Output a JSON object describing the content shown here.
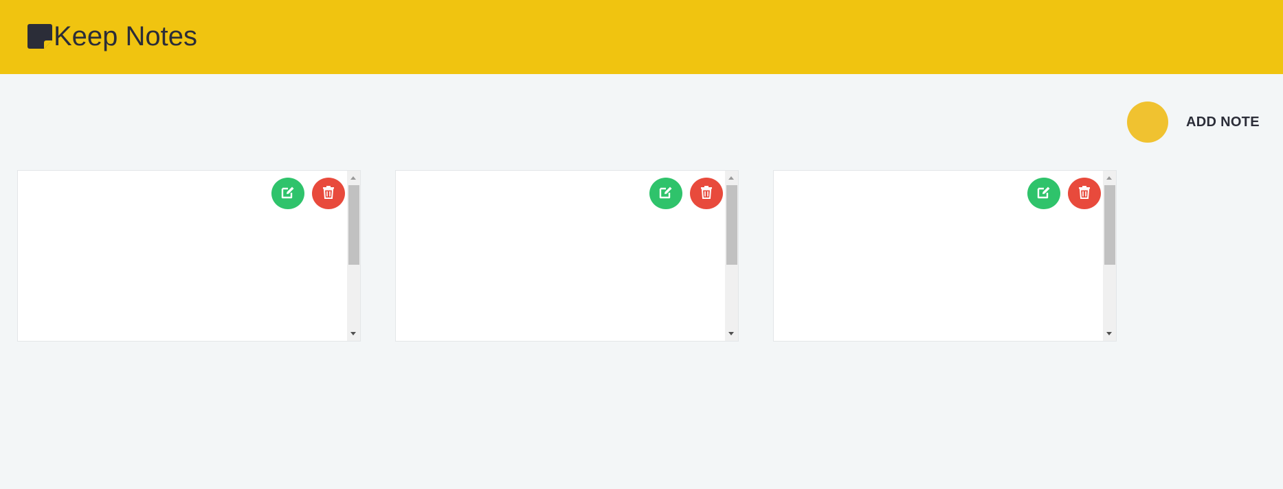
{
  "header": {
    "app_title": "Keep Notes",
    "logo_icon": "sticky-note-icon",
    "background_color": "#f0c410"
  },
  "toolbar": {
    "add_note_label": "ADD NOTE",
    "add_button_color": "#f0c230"
  },
  "notes": [
    {
      "edit_icon": "edit-icon",
      "delete_icon": "trash-icon"
    },
    {
      "edit_icon": "edit-icon",
      "delete_icon": "trash-icon"
    },
    {
      "edit_icon": "edit-icon",
      "delete_icon": "trash-icon"
    }
  ],
  "colors": {
    "edit": "#2fc36b",
    "delete": "#e84a3c",
    "page_background": "#f3f6f7"
  }
}
